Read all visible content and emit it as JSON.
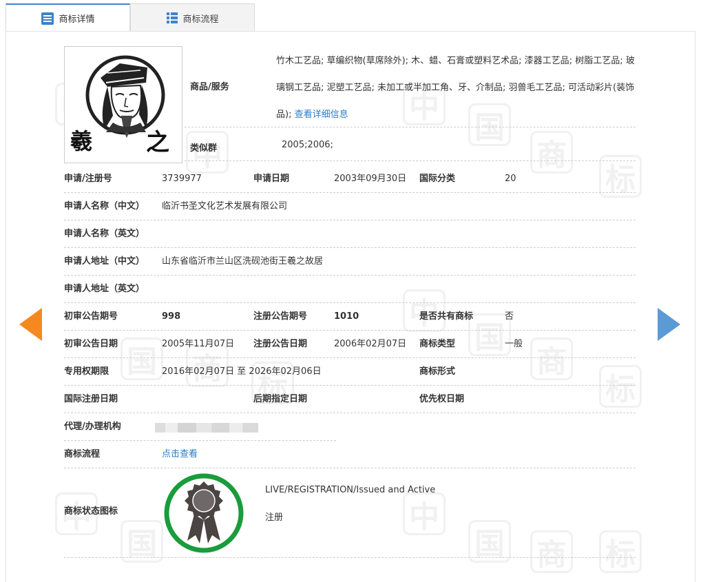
{
  "tabs": [
    {
      "label": "商标详情",
      "icon": "list-icon"
    },
    {
      "label": "商标流程",
      "icon": "grid-icon"
    }
  ],
  "watermark": [
    "中",
    "国",
    "商",
    "标"
  ],
  "logo": {
    "text_left": "羲",
    "text_right": "之"
  },
  "goods": {
    "label": "商品/服务",
    "text": "竹木工艺品; 草编织物(草席除外); 木、蜡、石膏或塑料艺术品; 漆器工艺品; 树脂工艺品; 玻璃钢工艺品; 泥塑工艺品; 未加工或半加工角、牙、介制品; 羽兽毛工艺品; 可活动彩片(装饰品); ",
    "more": "查看详细信息"
  },
  "similar": {
    "label": "类似群",
    "value": "2005;2006;"
  },
  "reg": {
    "no_label": "申请/注册号",
    "no": "3739977",
    "date_label": "申请日期",
    "date": "2003年09月30日",
    "class_label": "国际分类",
    "class": "20"
  },
  "applicant_cn": {
    "label": "申请人名称（中文）",
    "value": "临沂书圣文化艺术发展有限公司"
  },
  "applicant_en": {
    "label": "申请人名称（英文）",
    "value": ""
  },
  "address_cn": {
    "label": "申请人地址（中文）",
    "value": "山东省临沂市兰山区洗砚池街王羲之故居"
  },
  "address_en": {
    "label": "申请人地址（英文）",
    "value": ""
  },
  "pub": {
    "prelim_no_label": "初审公告期号",
    "prelim_no": "998",
    "reg_no_label": "注册公告期号",
    "reg_no": "1010",
    "shared_label": "是否共有商标",
    "shared": "否"
  },
  "pubdate": {
    "prelim_date_label": "初审公告日期",
    "prelim_date": "2005年11月07日",
    "reg_date_label": "注册公告日期",
    "reg_date": "2006年02月07日",
    "type_label": "商标类型",
    "type": "一般"
  },
  "term": {
    "label": "专用权期限",
    "value": "2016年02月07日 至 2026年02月06日",
    "form_label": "商标形式",
    "form": ""
  },
  "intl": {
    "intl_label": "国际注册日期",
    "later_label": "后期指定日期",
    "priority_label": "优先权日期"
  },
  "agent": {
    "label": "代理/办理机构",
    "value": ""
  },
  "process": {
    "label": "商标流程",
    "link": "点击查看"
  },
  "status": {
    "label": "商标状态图标",
    "en": "LIVE/REGISTRATION/Issued and Active",
    "cn": "注册",
    "ring_color": "#1a9c3c"
  },
  "colors": {
    "accent": "#3d83c5",
    "prev_arrow": "#f5891f",
    "next_arrow": "#5b9bd5"
  }
}
